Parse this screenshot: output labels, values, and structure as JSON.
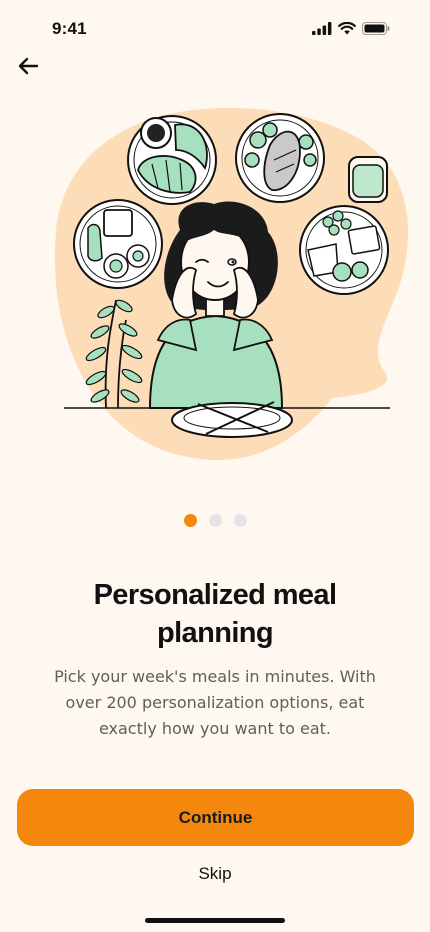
{
  "status_bar": {
    "time": "9:41",
    "icons": [
      "signal-icon",
      "wifi-icon",
      "battery-icon"
    ]
  },
  "header": {
    "back_icon": "arrow-left-icon"
  },
  "illustration": {
    "subject": "person-daydreaming-about-meals",
    "accent_blob_color": "#FDDDB8",
    "food_accent_color": "#A7E0BE"
  },
  "pagination": {
    "total": 3,
    "active_index": 0,
    "active_color": "#F4880E",
    "inactive_color": "#E5E3E6"
  },
  "content": {
    "title_line1": "Personalized meal",
    "title_line2": "planning",
    "subtitle_line1": "Pick your week's meals in minutes. With",
    "subtitle_line2": "over 200 personalization options, eat",
    "subtitle_line3": "exactly how you want to eat."
  },
  "actions": {
    "continue_label": "Continue",
    "skip_label": "Skip",
    "primary_color": "#F4880E"
  }
}
